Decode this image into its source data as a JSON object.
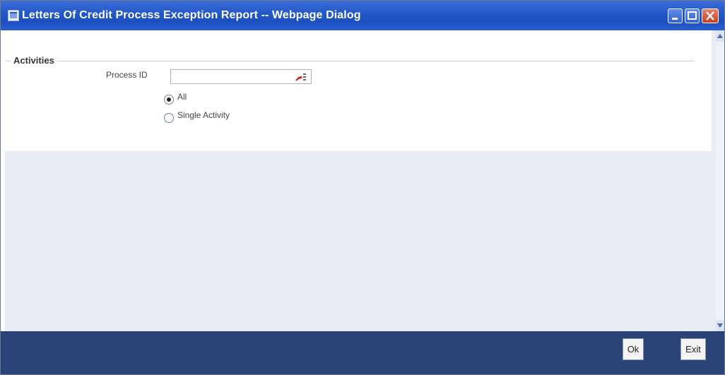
{
  "window": {
    "title": "Letters Of Credit Process Exception Report -- Webpage Dialog"
  },
  "form": {
    "section_legend": "Activities",
    "process_id_label": "Process ID",
    "process_id_value": "",
    "radio_all_label": "All",
    "radio_all_selected": true,
    "radio_single_label": "Single Activity"
  },
  "footer": {
    "ok_label": "Ok",
    "exit_label": "Exit"
  },
  "colors": {
    "titlebar": "#2459c9",
    "footer": "#2a4478",
    "client_bg": "#e8ecf5"
  },
  "icons": [
    "app-icon",
    "minimize-icon",
    "maximize-icon",
    "close-icon",
    "lov-search-icon",
    "scroll-up-icon",
    "scroll-down-icon"
  ]
}
